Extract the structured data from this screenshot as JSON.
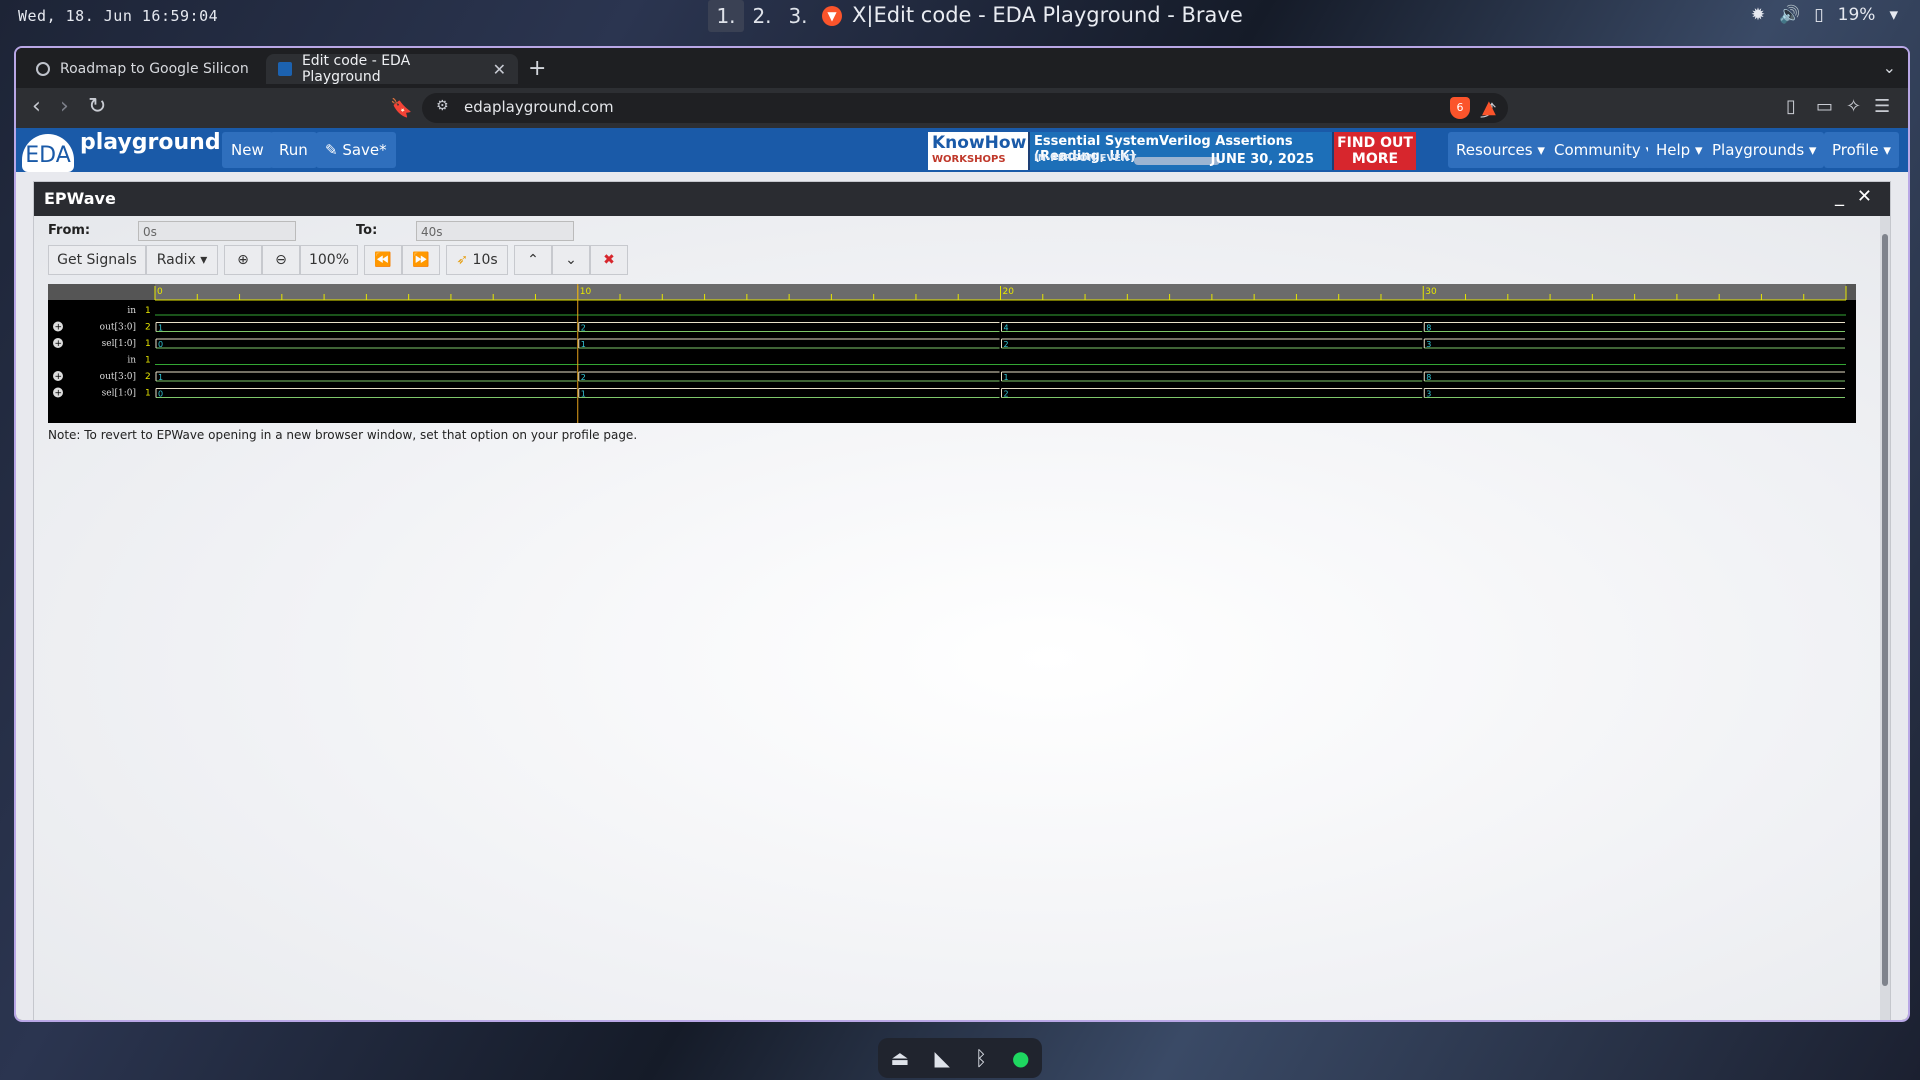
{
  "os": {
    "clock": "Wed, 18. Jun  16:59:04",
    "workspaces": [
      "1.",
      "2.",
      "3."
    ],
    "window_title": "X|Edit code - EDA Playground - Brave",
    "battery": "19%",
    "tray_icons": [
      "settings-icon",
      "volume-icon",
      "battery-icon",
      "chevron-down-icon"
    ]
  },
  "browser": {
    "tabs": [
      {
        "label": "Roadmap to Google Silicon",
        "active": false
      },
      {
        "label": "Edit code - EDA Playground",
        "active": true
      }
    ],
    "new_tab": "+",
    "url": "edaplayground.com",
    "shield_badge": "6",
    "rewards_badge": "1"
  },
  "site": {
    "logo_eda": "EDA",
    "logo_text": "playground",
    "buttons": {
      "new": "New",
      "run": "Run",
      "save": "✎ Save*"
    },
    "ad": {
      "brand": "KnowHow",
      "brand_sub": "WORKSHOPS",
      "title": "Essential SystemVerilog Assertions (Reading, UK)",
      "event": "IN-PERSON EVENT",
      "date": "JUNE 30, 2025",
      "cta": "FIND OUT MORE"
    },
    "menus": {
      "resources": "Resources ▾",
      "community": "Community ▾",
      "help": "Help ▾",
      "playgrounds": "Playgrounds ▾",
      "profile": "Profile ▾"
    }
  },
  "epwave": {
    "title": "EPWave",
    "from_label": "From:",
    "from_value": "0s",
    "to_label": "To:",
    "to_value": "40s",
    "toolbar": {
      "get_signals": "Get Signals",
      "radix": "Radix ▾",
      "zoom_level": "100%",
      "cursor_time": "10s"
    },
    "time_markers": [
      "0",
      "10",
      "20",
      "30"
    ],
    "signals": [
      {
        "name": "in",
        "width": "1",
        "expandable": false,
        "values": [],
        "bus": false
      },
      {
        "name": "out[3:0]",
        "width": "2",
        "expandable": true,
        "values": [
          "1",
          "2",
          "4",
          "8"
        ],
        "bus": true
      },
      {
        "name": "sel[1:0]",
        "width": "1",
        "expandable": true,
        "values": [
          "0",
          "1",
          "2",
          "3"
        ],
        "bus": true
      },
      {
        "name": "in",
        "width": "1",
        "expandable": false,
        "values": [],
        "bus": false
      },
      {
        "name": "out[3:0]",
        "width": "2",
        "expandable": true,
        "values": [
          "1",
          "2",
          "1",
          "8"
        ],
        "bus": true
      },
      {
        "name": "sel[1:0]",
        "width": "1",
        "expandable": true,
        "values": [
          "0",
          "1",
          "2",
          "3"
        ],
        "bus": true
      }
    ],
    "note": "Note: To revert to EPWave opening in a new browser window, set that option on your profile page."
  }
}
